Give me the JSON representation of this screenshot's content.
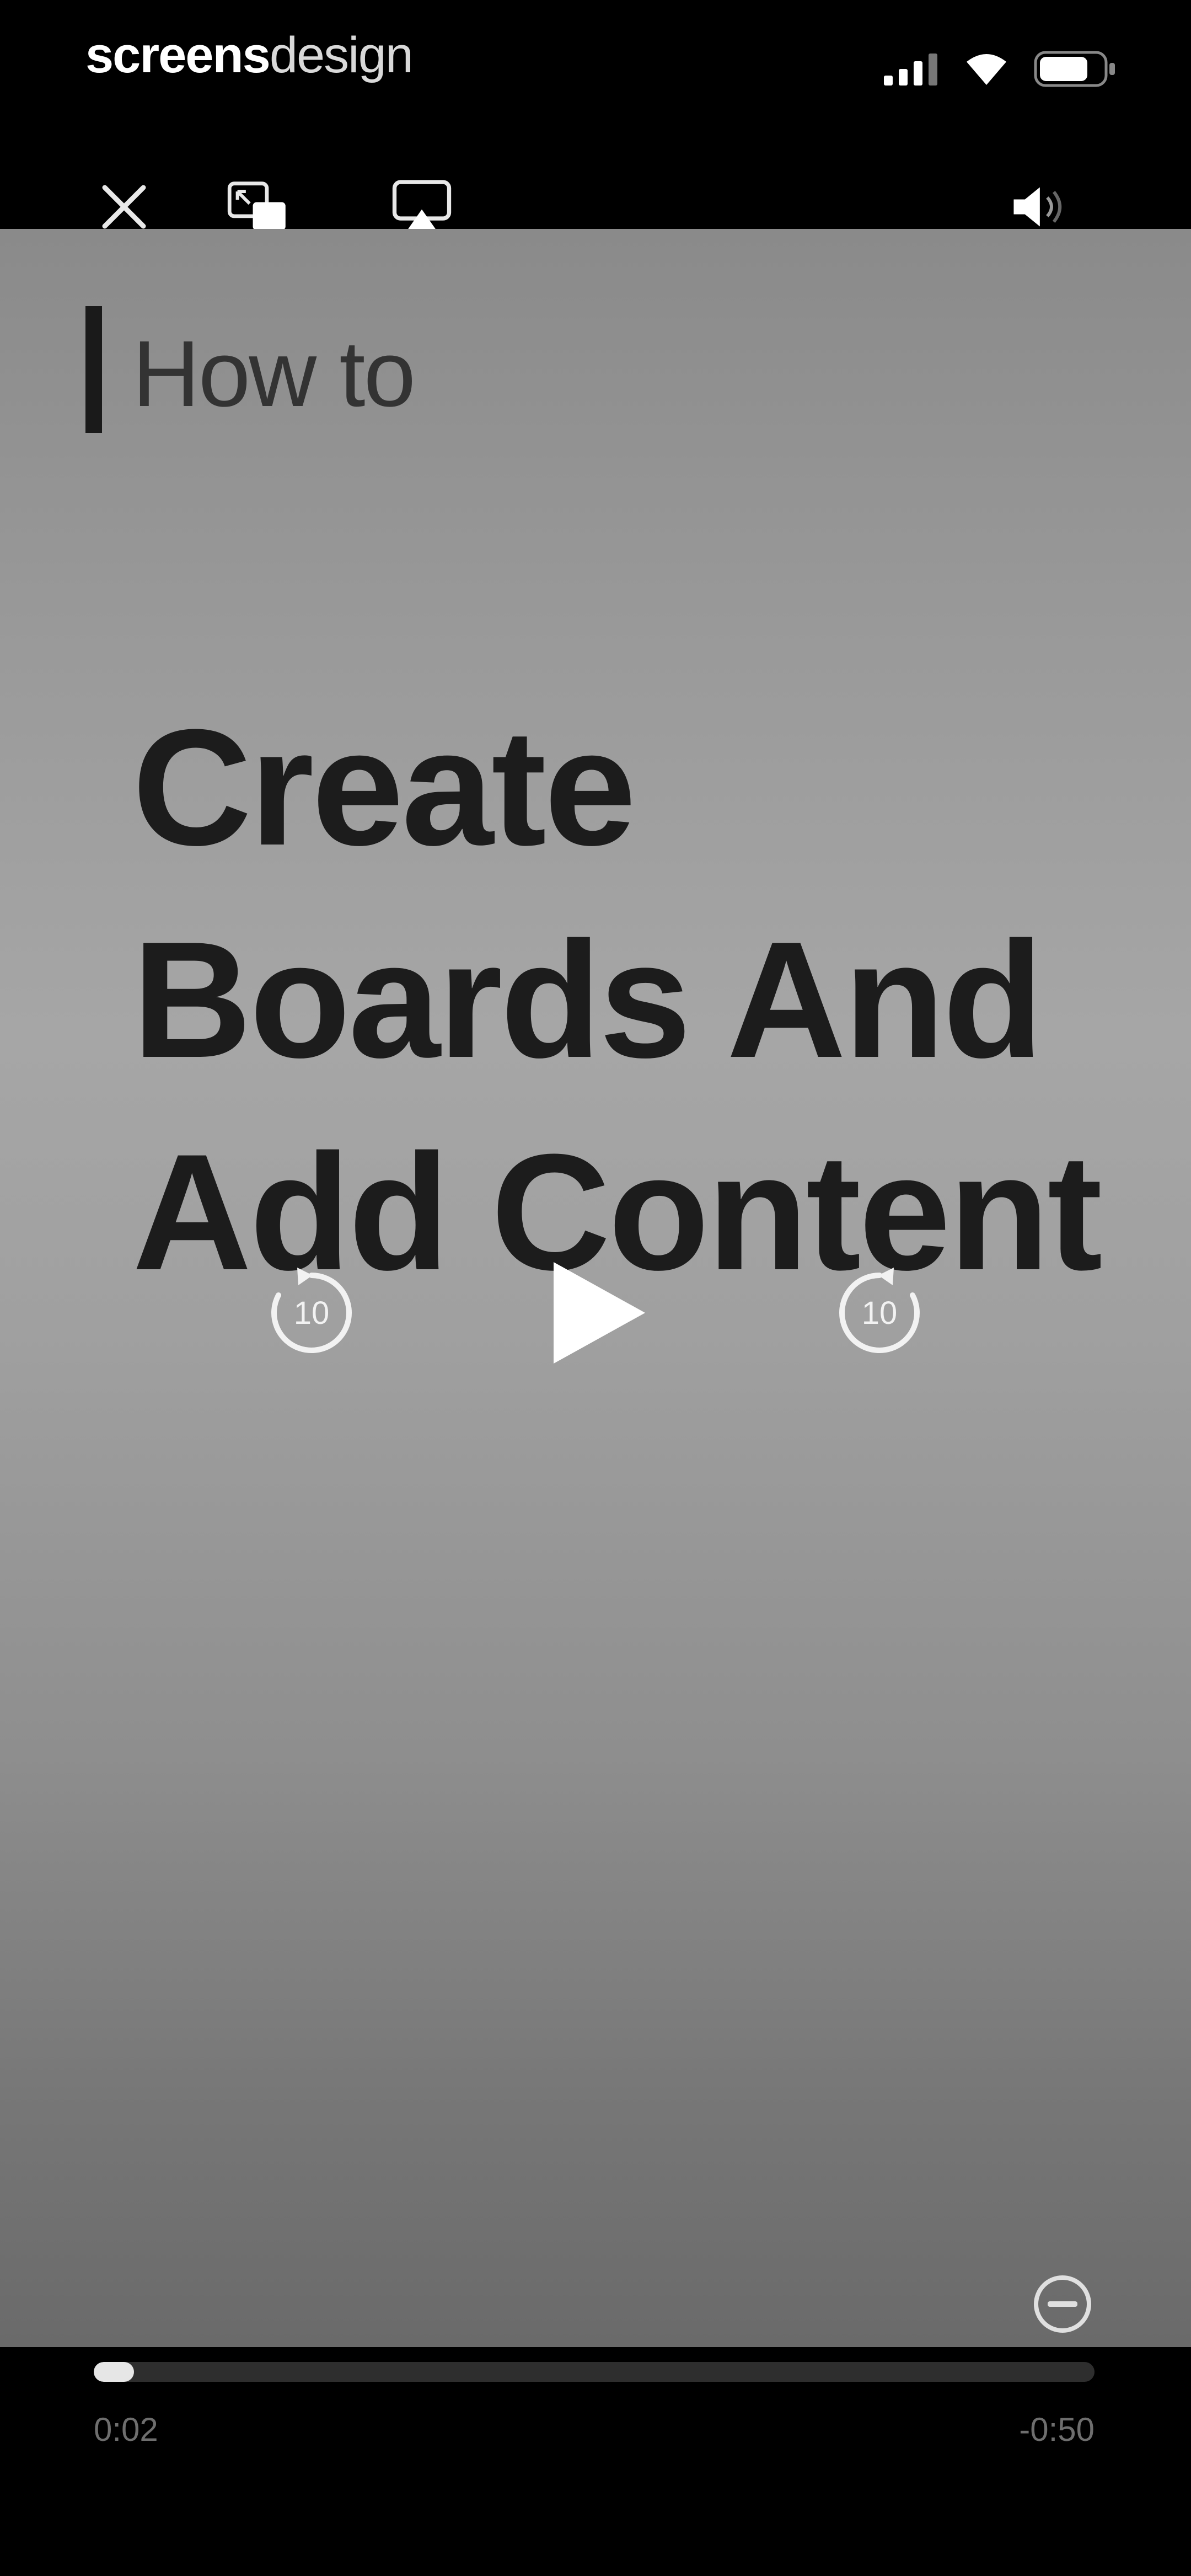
{
  "status_bar": {
    "brand_bold": "screens",
    "brand_light": "design",
    "icons": [
      "signal-icon",
      "wifi-icon",
      "battery-icon"
    ]
  },
  "player": {
    "top_controls": [
      "close-icon",
      "picture-in-picture-icon",
      "airplay-icon",
      "volume-icon"
    ],
    "video": {
      "eyebrow": "How to",
      "headline_lines": [
        "Create",
        "Boards And",
        "Add Content"
      ]
    },
    "skip_back_label": "10",
    "skip_forward_label": "10",
    "progress": 0.04,
    "elapsed": "0:02",
    "remaining": "-0:50"
  },
  "colors": {
    "background": "#000000",
    "headline": "#1c1c1c",
    "eyebrow": "#333333",
    "controls": "#ffffff",
    "scrubber_track": "#2e2e2e",
    "scrubber_fill": "#e6e6e6",
    "time_text": "#6e6e6e"
  }
}
